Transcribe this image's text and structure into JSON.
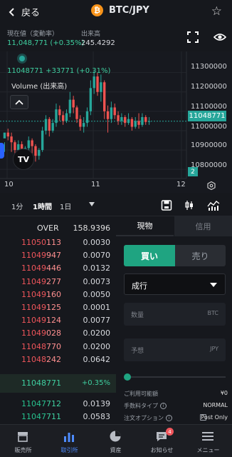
{
  "header": {
    "back_label": "戻る",
    "pair": "BTC/JPY",
    "coin_symbol": "₿"
  },
  "info": {
    "current_label": "現在値（変動率）",
    "current_value": "11,048,771 (+0.35%)",
    "volume_label": "出来高",
    "volume_value": "245.4292"
  },
  "chart": {
    "candle_info": "11048771 +33771 (+0.31%)",
    "volume_label": "Volume (出来高)",
    "price_tag": "11048771",
    "count_tag": "2",
    "tv_logo": "TV",
    "y_labels": [
      "11300000",
      "11200000",
      "11100000",
      "11000000",
      "10900000",
      "10800000"
    ],
    "x_labels": [
      "10",
      "11",
      "12"
    ]
  },
  "chart_data": {
    "type": "candlestick",
    "ylim": [
      10760000,
      11380000
    ],
    "x_ticks": [
      "10",
      "11",
      "12"
    ],
    "candles": [
      [
        10960000,
        10990000,
        10940000,
        10890000
      ],
      [
        10990000,
        10970000,
        11010000,
        10950000
      ],
      [
        10970000,
        10940000,
        10990000,
        10890000
      ],
      [
        10940000,
        10900000,
        10950000,
        10870000
      ],
      [
        10900000,
        10930000,
        10950000,
        10870000
      ],
      [
        10930000,
        10880000,
        10945000,
        10860000
      ],
      [
        10880000,
        10910000,
        10920000,
        10850000
      ],
      [
        10910000,
        10950000,
        10970000,
        10890000
      ],
      [
        10950000,
        10920000,
        10960000,
        10880000
      ],
      [
        10920000,
        10870000,
        10930000,
        10840000
      ],
      [
        10870000,
        10900000,
        10910000,
        10850000
      ],
      [
        10900000,
        11000000,
        11020000,
        10890000
      ],
      [
        11000000,
        11060000,
        11080000,
        10980000
      ],
      [
        11060000,
        11000000,
        11070000,
        10970000
      ],
      [
        11000000,
        11040000,
        11060000,
        10990000
      ],
      [
        11040000,
        11110000,
        11140000,
        11020000
      ],
      [
        11110000,
        11080000,
        11130000,
        11050000
      ],
      [
        11080000,
        11050000,
        11100000,
        11030000
      ],
      [
        11050000,
        11090000,
        11110000,
        11040000
      ],
      [
        11090000,
        11160000,
        11200000,
        11070000
      ],
      [
        11160000,
        11120000,
        11180000,
        11090000
      ],
      [
        11120000,
        11060000,
        11130000,
        11040000
      ],
      [
        11060000,
        11020000,
        11080000,
        11000000
      ],
      [
        11020000,
        11040000,
        11070000,
        10990000
      ],
      [
        11040000,
        11100000,
        11120000,
        11020000
      ],
      [
        11100000,
        11220000,
        11260000,
        11080000
      ],
      [
        11220000,
        11280000,
        11310000,
        11190000
      ],
      [
        11280000,
        11200000,
        11300000,
        11180000
      ],
      [
        11200000,
        11250000,
        11290000,
        11150000
      ],
      [
        11250000,
        11100000,
        11260000,
        11060000
      ],
      [
        11100000,
        11060000,
        11130000,
        10990000
      ],
      [
        11060000,
        11120000,
        11150000,
        11040000
      ],
      [
        11120000,
        11080000,
        11140000,
        11060000
      ],
      [
        11080000,
        11050000,
        11100000,
        11030000
      ],
      [
        11050000,
        11070000,
        11090000,
        11030000
      ],
      [
        11070000,
        11040000,
        11080000,
        11020000
      ],
      [
        11040000,
        11060000,
        11090000,
        11030000
      ],
      [
        11060000,
        11020000,
        11070000,
        11000000
      ],
      [
        11020000,
        11050000,
        11070000,
        11010000
      ],
      [
        11050000,
        11030000,
        11090000,
        11010000
      ],
      [
        11030000,
        11070000,
        11090000,
        11020000
      ],
      [
        11070000,
        11045000,
        11080000,
        11030000
      ],
      [
        11045000,
        11048771,
        11070000,
        11030000
      ]
    ]
  },
  "timeframes": {
    "m1": "1分",
    "h1": "1時間",
    "d1": "1日"
  },
  "orderbook": {
    "header_label": "OVER",
    "header_value": "158.9396",
    "asks": [
      {
        "base": "11050",
        "tail": "113",
        "qty": "0.0030"
      },
      {
        "base": "11049",
        "tail": "947",
        "qty": "0.0070"
      },
      {
        "base": "11049",
        "tail": "446",
        "qty": "0.0132"
      },
      {
        "base": "11049",
        "tail": "277",
        "qty": "0.0073"
      },
      {
        "base": "11049",
        "tail": "160",
        "qty": "0.0050"
      },
      {
        "base": "11049",
        "tail": "125",
        "qty": "0.0001"
      },
      {
        "base": "11049",
        "tail": "124",
        "qty": "0.0077"
      },
      {
        "base": "11049",
        "tail": "028",
        "qty": "0.0200"
      },
      {
        "base": "11048",
        "tail": "770",
        "qty": "0.0200"
      },
      {
        "base": "11048",
        "tail": "242",
        "qty": "0.0642"
      }
    ],
    "mid_price": "11048771",
    "mid_change": "+0.35%",
    "bids": [
      {
        "base": "11047",
        "tail": "712",
        "qty": "0.0139"
      },
      {
        "base": "11047",
        "tail": "711",
        "qty": "0.0583"
      }
    ]
  },
  "order": {
    "tab_spot": "現物",
    "tab_margin": "信用",
    "buy_label": "買い",
    "sell_label": "売り",
    "order_type": "成行",
    "qty_placeholder": "数量",
    "qty_unit": "BTC",
    "est_placeholder": "予想",
    "est_unit": "JPY",
    "available_label": "ご利用可能額",
    "available_value": "¥0",
    "fee_label": "手数料タイプ",
    "fee_value": "NORMAL",
    "options_label": "注文オプション",
    "post_only": "Post Only",
    "slider_fraction": 0
  },
  "nav": {
    "items": [
      {
        "label": "販売所",
        "icon": "store-icon"
      },
      {
        "label": "取引所",
        "icon": "bar-chart-icon"
      },
      {
        "label": "資産",
        "icon": "pie-chart-icon"
      },
      {
        "label": "お知らせ",
        "icon": "message-icon",
        "badge": "4"
      },
      {
        "label": "メニュー",
        "icon": "menu-icon"
      }
    ]
  },
  "colors": {
    "up": "#26a69a",
    "down": "#ef5350",
    "accent": "#1fa481",
    "active_nav": "#4e8cff"
  }
}
